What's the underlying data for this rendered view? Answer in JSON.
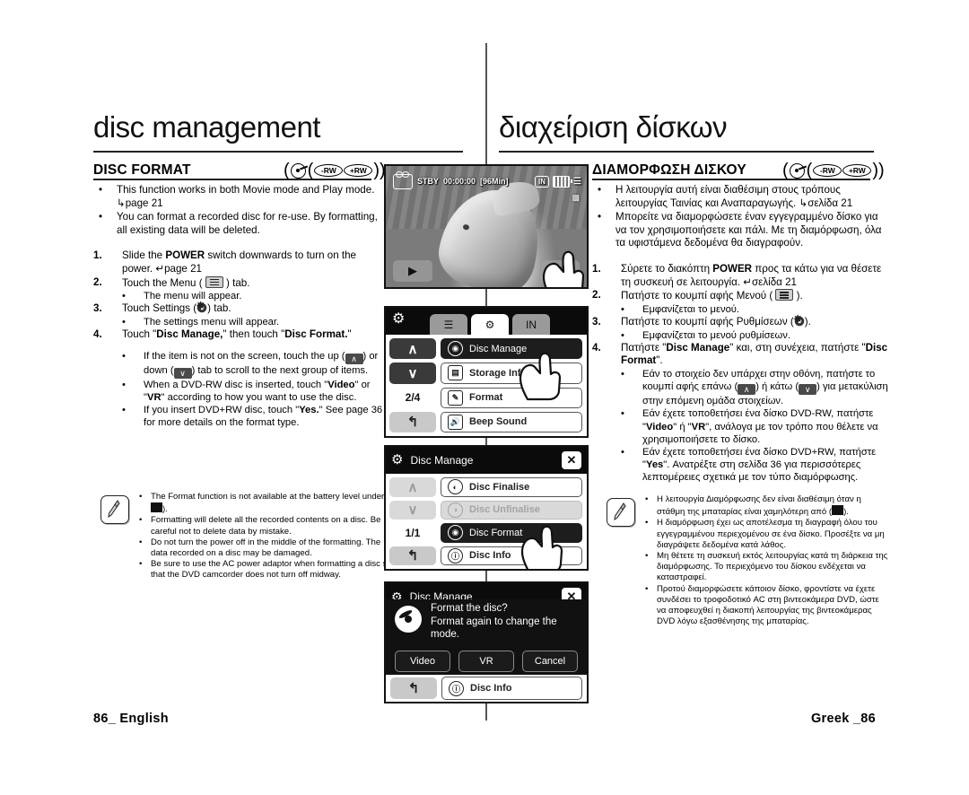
{
  "chapter": {
    "title_en": "disc management",
    "title_gr": "διαχείριση δίσκων"
  },
  "section": {
    "title_en": "DISC FORMAT",
    "title_gr": "ΔΙΑΜΟΡΦΩΣΗ ΔΙΣΚΟΥ",
    "badge_rw": "-RW",
    "badge_plusrw": "+RW",
    "paren_open": "(",
    "paren_close": "))",
    "mid_paren": "("
  },
  "english": {
    "bullets": [
      "This function works in both Movie mode and Play mode. ↳page 21",
      "You can format a recorded disc for re-use. By formatting, all existing data will be deleted."
    ],
    "steps": [
      {
        "num": "1.",
        "text_pre": "Slide the ",
        "bold": "POWER",
        "text_post": " switch downwards to turn on the power. ↳page 21",
        "subs": []
      },
      {
        "num": "2.",
        "text_pre": "Touch the Menu ( ",
        "bold": "",
        "text_post": " ) tab.",
        "subs": [
          "The menu will appear."
        ]
      },
      {
        "num": "3.",
        "text_pre": "Touch Settings ( ",
        "bold": "",
        "text_post": " ) tab.",
        "subs": [
          "The settings menu will appear."
        ]
      },
      {
        "num": "4.",
        "text_pre": "Touch \"",
        "bold": "Disc Manage,\"",
        "text_post": " then touch \"Disc Format.\"",
        "subs": []
      }
    ],
    "step4_subs": [
      "If the item is not on the screen, touch the up ( ^ ) or down ( v ) tab to scroll to the next group of items.",
      "When a DVD-RW disc is inserted, touch \"Video\" or \"VR\" according to how you want to use the disc.",
      "If you insert DVD+RW disc, touch \"Yes.\" See page 36 for more details on the format type."
    ],
    "notes": [
      "The Format function is not available at the battery level under ( ▪ ).",
      "Formatting will delete all the recorded contents on a disc. Be careful not to delete data by mistake.",
      "Do not turn the power off in the middle of the formatting. The data recorded on a disc may be damaged.",
      "Be sure to use the AC power adaptor when formatting a disc so that the DVD camcorder does not turn off midway."
    ]
  },
  "greek": {
    "bullets": [
      "Η λειτουργία αυτή είναι διαθέσιμη στους τρόπους λειτουργίας Ταινίας και Αναπαραγωγής. ↳σελίδα 21",
      "Μπορείτε να διαμορφώσετε έναν εγγεγραμμένο δίσκο για να τον χρησιμοποιήσετε και πάλι. Με τη διαμόρφωση, όλα τα υφιστάμενα δεδομένα θα διαγραφούν."
    ],
    "steps": [
      {
        "num": "1.",
        "text": "Σύρετε το διακόπτη POWER προς τα κάτω για να θέσετε τη συσκευή σε λειτουργία. ↳σελίδα 21",
        "subs": []
      },
      {
        "num": "2.",
        "text": "Πατήστε το κουμπί αφής Μενού ( ).",
        "subs": [
          "Εμφανίζεται το μενού."
        ]
      },
      {
        "num": "3.",
        "text": "Πατήστε το κουμπί αφής Ρυθμίσεων ( ).",
        "subs": [
          "Εμφανίζεται το μενού ρυθμίσεων."
        ]
      },
      {
        "num": "4.",
        "text": "Πατήστε \"Disc Manage\" και, στη συνέχεια, πατήστε \"Disc Format\".",
        "subs": []
      }
    ],
    "step4_subs": [
      "Εάν το στοιχείο δεν υπάρχει στην οθόνη, πατήστε το κουμπί αφής επάνω ( ^ ) ή κάτω ( v ) για μετακύλιση στην επόμενη ομάδα στοιχείων.",
      "Εάν έχετε τοποθετήσει ένα δίσκο DVD-RW, πατήστε \"Video\" ή \"VR\", ανάλογα με τον τρόπο που θέλετε να χρησιμοποιήσετε το δίσκο.",
      "Εάν έχετε τοποθετήσει ένα δίσκο DVD+RW, πατήστε \"Yes\". Ανατρέξτε στη σελίδα 36 για περισσότερες λεπτομέρειες σχετικά με τον τύπο διαμόρφωσης."
    ],
    "notes": [
      "Η λειτουργία Διαμόρφωσης δεν είναι διαθέσιμη όταν η στάθμη της μπαταρίας είναι χαμηλότερη από ( ▪ ).",
      "Η διαμόρφωση έχει ως αποτέλεσμα τη διαγραφή όλου του εγγεγραμμένου περιεχομένου σε ένα δίσκο. Προσέξτε να μη διαγράψετε δεδομένα κατά λάθος.",
      "Μη θέτετε τη συσκευή εκτός λειτουργίας κατά τη διάρκεια της διαμόρφωσης. Το περιεχόμενο του δίσκου ενδέχεται να καταστραφεί.",
      "Προτού διαμορφώσετε κάποιον δίσκο, φροντίστε να έχετε συνδέσει το τροφοδοτικό AC στη βιντεοκάμερα DVD, ώστε να αποφευχθεί η διακοπή λειτουργίας της βιντεοκάμερας DVD λόγω εξασθένησης της μπαταρίας."
    ]
  },
  "screens": {
    "screen1": {
      "osd_status": "STBY",
      "osd_time": "00:00:00",
      "osd_remain": "[96Min]",
      "badge_in": "IN",
      "btn_left": "▶",
      "btn_right": "▤"
    },
    "screen2": {
      "page_indicator": "2/4",
      "up_label": "∧",
      "down_label": "∨",
      "back_label": "↰",
      "tab_in": "IN",
      "items": [
        {
          "label": "Disc Manage",
          "state": "selected"
        },
        {
          "label": "Storage Info",
          "state": "normal"
        },
        {
          "label": "Format",
          "state": "normal"
        },
        {
          "label": "Beep Sound",
          "state": "normal"
        }
      ]
    },
    "screen3": {
      "title": "Disc Manage",
      "close_label": "✕",
      "page_indicator": "1/1",
      "up_label": "∧",
      "down_label": "∨",
      "back_label": "↰",
      "items": [
        {
          "label": "Disc Finalise",
          "state": "normal"
        },
        {
          "label": "Disc Unfinalise",
          "state": "disabled"
        },
        {
          "label": "Disc Format",
          "state": "selected"
        },
        {
          "label": "Disc Info",
          "state": "normal"
        }
      ]
    },
    "screen4": {
      "behind_title": "Disc Manage",
      "behind_close": "✕",
      "message_line1": "Format the disc?",
      "message_line2": "Format again to change the",
      "message_line3": "mode.",
      "buttons": [
        "Video",
        "VR",
        "Cancel"
      ],
      "behind_bottom_item": "Disc Info",
      "back_label": "↰"
    }
  },
  "footer": {
    "left": "86_ English",
    "right": "Greek _86"
  }
}
